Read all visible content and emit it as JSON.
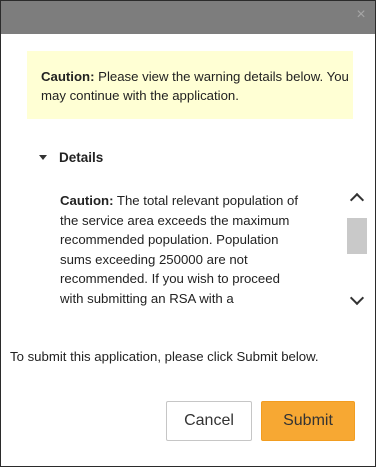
{
  "dialog": {
    "close_glyph": "×"
  },
  "caution": {
    "label": "Caution:",
    "text": " Please view the warning details below. You may continue with the application."
  },
  "details": {
    "header": "Details",
    "label": "Caution:",
    "text": " The total relevant population of the service area exceeds the maximum recommended population. Population sums exceeding 250000 are not recommended. If you wish to proceed with submitting an RSA with a"
  },
  "footer": {
    "text": "To submit this application, please click Submit below."
  },
  "buttons": {
    "cancel": "Cancel",
    "submit": "Submit"
  }
}
